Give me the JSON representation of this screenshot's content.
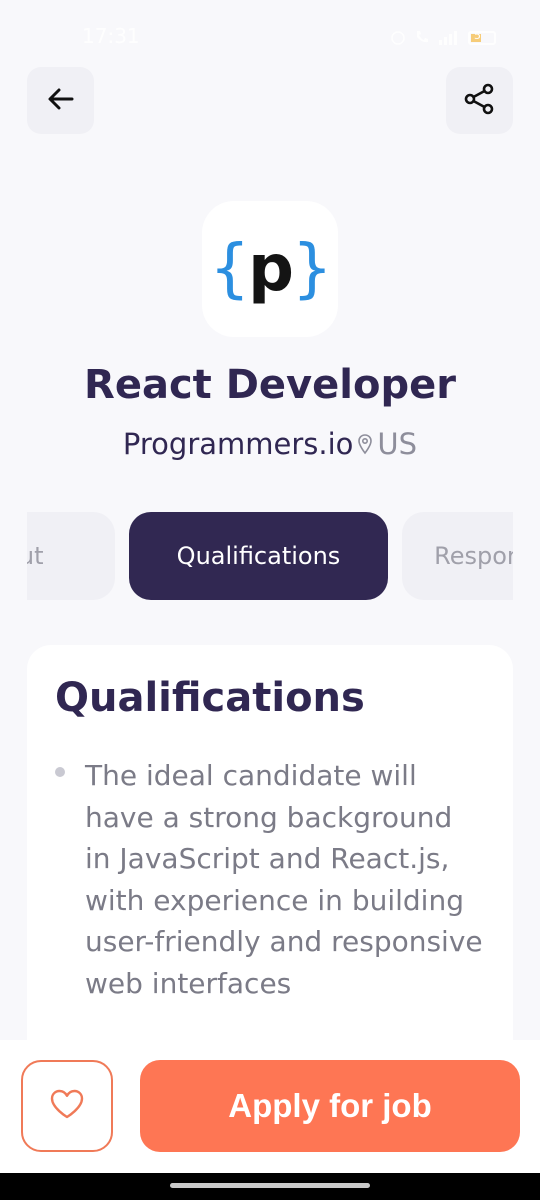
{
  "status_bar": {
    "time": "17:31",
    "battery": "5"
  },
  "header": {
    "back_icon": "arrow-left-icon",
    "share_icon": "share-icon"
  },
  "company_logo": {
    "brace_open": "{",
    "letter": "p",
    "brace_close": "}"
  },
  "job": {
    "title": "React Developer",
    "company": "Programmers.io",
    "location": "US"
  },
  "tabs": [
    {
      "label": "About",
      "active": false
    },
    {
      "label": "Qualifications",
      "active": true
    },
    {
      "label": "Responsibilities",
      "active": false
    }
  ],
  "section": {
    "heading": "Qualifications",
    "bullets": [
      "The ideal candidate will have a strong background in JavaScript and React.js, with experience in building user-friendly and responsive web interfaces"
    ]
  },
  "actions": {
    "favorite_icon": "heart-icon",
    "apply_label": "Apply for job"
  },
  "colors": {
    "primary": "#312852",
    "accent": "#FE7654",
    "background": "#F8F8FB"
  }
}
